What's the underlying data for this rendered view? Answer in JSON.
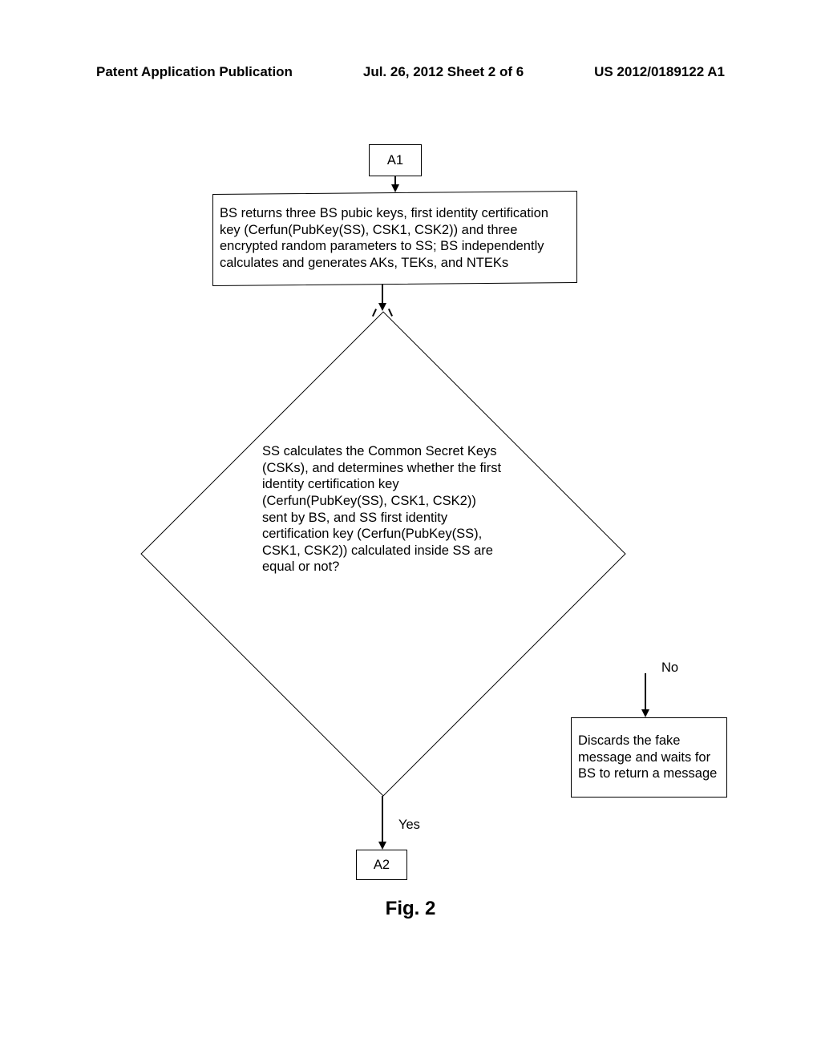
{
  "header": {
    "left": "Patent Application Publication",
    "center": "Jul. 26, 2012  Sheet 2 of 6",
    "right": "US 2012/0189122 A1"
  },
  "flowchart": {
    "a1": "A1",
    "step1": "BS returns three BS pubic keys, first identity certification key (Cerfun(PubKey(SS), CSK1, CSK2)) and three encrypted random parameters to SS; BS independently calculates and generates AKs, TEKs, and NTEKs",
    "decision": "SS calculates the Common Secret Keys (CSKs), and determines whether the first identity certification key (Cerfun(PubKey(SS), CSK1, CSK2)) sent by BS, and SS first identity certification key (Cerfun(PubKey(SS), CSK1, CSK2)) calculated inside SS are equal or not?",
    "discard": "Discards the fake message and waits for BS to return a message",
    "yes_label": "Yes",
    "no_label": "No",
    "a2": "A2"
  },
  "caption": "Fig. 2"
}
